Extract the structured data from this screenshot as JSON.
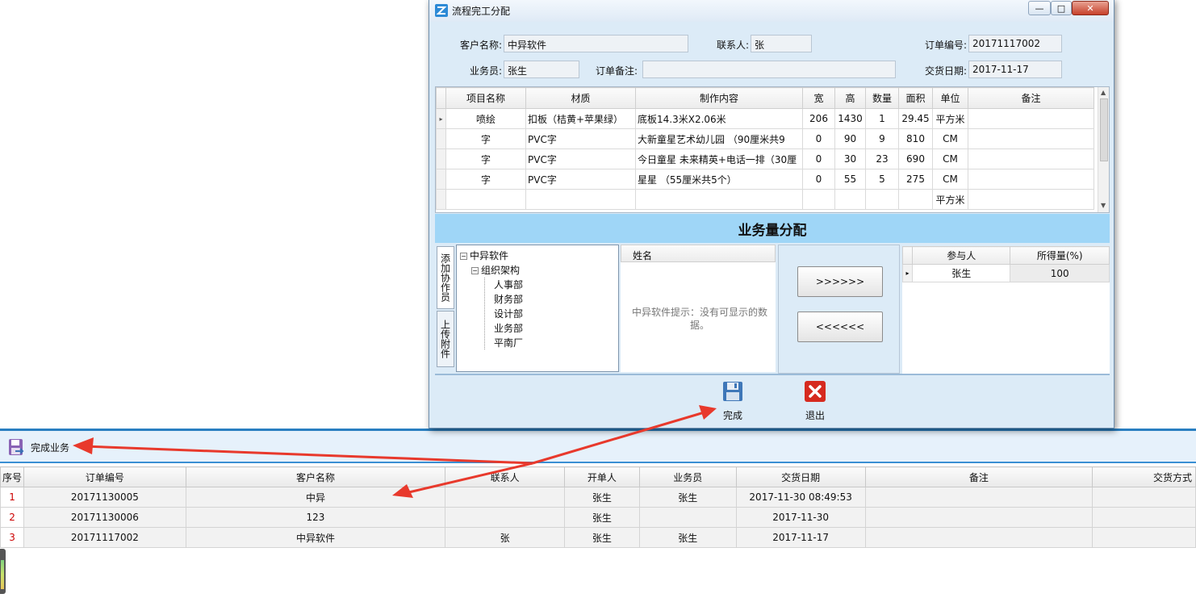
{
  "dialog": {
    "title": "流程完工分配",
    "customer_label": "客户名称:",
    "customer_value": "中异软件",
    "contact_label": "联系人:",
    "contact_value": "张",
    "order_no_label": "订单编号:",
    "order_no_value": "20171117002",
    "salesman_label": "业务员:",
    "salesman_value": "张生",
    "order_note_label": "订单备注:",
    "order_note_value": "",
    "delivery_label": "交货日期:",
    "delivery_value": "2017-11-17",
    "grid": {
      "columns": [
        "项目名称",
        "材质",
        "制作内容",
        "宽",
        "高",
        "数量",
        "面积",
        "单位",
        "备注"
      ],
      "rows": [
        [
          "喷绘",
          "扣板（桔黄+苹果绿）",
          "底板14.3米X2.06米",
          "206",
          "1430",
          "1",
          "29.45",
          "平方米",
          ""
        ],
        [
          "字",
          "PVC字",
          "大新童星艺术幼儿园 （90厘米共9",
          "0",
          "90",
          "9",
          "810",
          "CM",
          ""
        ],
        [
          "字",
          "PVC字",
          "今日童星 未来精英+电话一排（30厘",
          "0",
          "30",
          "23",
          "690",
          "CM",
          ""
        ],
        [
          "字",
          "PVC字",
          "星星 （55厘米共5个）",
          "0",
          "55",
          "5",
          "275",
          "CM",
          ""
        ],
        [
          "",
          "",
          "",
          "",
          "",
          "",
          "",
          "平方米",
          ""
        ]
      ]
    },
    "alloc_title": "业务量分配",
    "tab_add": "添加协作员",
    "tab_upload": "上传附件",
    "tree": {
      "root": "中异软件",
      "org": "组织架构",
      "depts": [
        "人事部",
        "财务部",
        "设计部",
        "业务部",
        "平南厂"
      ]
    },
    "name_header": "姓名",
    "empty_hint": "中异软件提示：没有可显示的数据。",
    "btn_add": ">>>>>>",
    "btn_remove": "<<<<<<",
    "participants": {
      "columns": [
        "参与人",
        "所得量(%)"
      ],
      "rows": [
        [
          "张生",
          "100"
        ]
      ]
    },
    "btn_finish": "完成",
    "btn_exit": "退出"
  },
  "main": {
    "toolbar_finish": "完成业务",
    "columns": [
      "序号",
      "订单编号",
      "客户名称",
      "联系人",
      "开单人",
      "业务员",
      "交货日期",
      "备注",
      "交货方式"
    ],
    "rows": [
      [
        "1",
        "20171130005",
        "中异",
        "",
        "张生",
        "张生",
        "2017-11-30 08:49:53",
        "",
        ""
      ],
      [
        "2",
        "20171130006",
        "123",
        "",
        "张生",
        "",
        "2017-11-30",
        "",
        ""
      ],
      [
        "3",
        "20171117002",
        "中异软件",
        "张",
        "张生",
        "张生",
        "2017-11-17",
        "",
        ""
      ]
    ]
  },
  "colors": {
    "accent": "#2a7fc1",
    "alloc_header": "#9fd6f7",
    "arrow": "#e8392c"
  }
}
